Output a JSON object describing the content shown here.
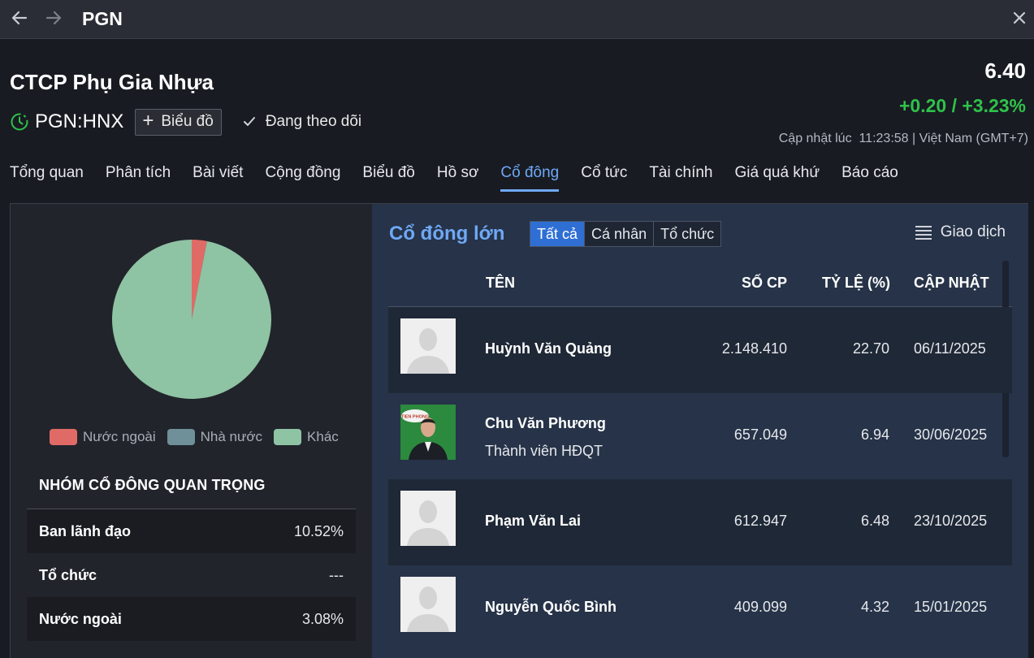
{
  "window": {
    "title": "PGN"
  },
  "header": {
    "company_name": "CTCP Phụ Gia Nhựa",
    "ticker": "PGN:HNX",
    "chart_button": "Biểu đồ",
    "follow_label": "Đang theo dõi",
    "price": "6.40",
    "change": "+0.20 / +3.23%",
    "updated": "Cập nhật lúc  11:23:58 | Việt Nam (GMT+7)",
    "colors": {
      "up": "#2fc24a",
      "accent": "#6fa8f5"
    }
  },
  "tabs": [
    {
      "label": "Tổng quan"
    },
    {
      "label": "Phân tích"
    },
    {
      "label": "Bài viết"
    },
    {
      "label": "Cộng đồng"
    },
    {
      "label": "Biểu đồ"
    },
    {
      "label": "Hồ sơ"
    },
    {
      "label": "Cổ đông",
      "active": true
    },
    {
      "label": "Cổ tức"
    },
    {
      "label": "Tài chính"
    },
    {
      "label": "Giá quá khứ"
    },
    {
      "label": "Báo cáo"
    }
  ],
  "ownership_chart": {
    "type": "pie",
    "legend": [
      {
        "label": "Nước ngoài",
        "color": "#e06b66"
      },
      {
        "label": "Nhà nước",
        "color": "#6f8f99"
      },
      {
        "label": "Khác",
        "color": "#8ec3a4"
      }
    ],
    "slices": [
      {
        "label": "Nước ngoài",
        "value": 3.08,
        "color": "#e06b66"
      },
      {
        "label": "Nhà nước",
        "value": 0,
        "color": "#6f8f99"
      },
      {
        "label": "Khác",
        "value": 96.92,
        "color": "#8ec3a4"
      }
    ]
  },
  "key_groups": {
    "title": "NHÓM CỔ ĐÔNG QUAN TRỌNG",
    "rows": [
      {
        "name": "Ban lãnh đạo",
        "value": "10.52%"
      },
      {
        "name": "Tổ chức",
        "value": "---"
      },
      {
        "name": "Nước ngoài",
        "value": "3.08%"
      }
    ]
  },
  "major_holders": {
    "title": "Cổ đông lớn",
    "filters": [
      "Tất cả",
      "Cá nhân",
      "Tổ chức"
    ],
    "active_filter": "Tất cả",
    "trades_label": "Giao dịch",
    "columns": [
      "TÊN",
      "SỐ CP",
      "TỶ LỆ (%)",
      "CẬP NHẬT"
    ],
    "rows": [
      {
        "name": "Huỳnh Văn Quảng",
        "role": "",
        "shares": "2.148.410",
        "ratio": "22.70",
        "date": "06/11/2025",
        "avatar": "placeholder-avatar"
      },
      {
        "name": "Chu Văn Phương",
        "role": "Thành viên HĐQT",
        "shares": "657.049",
        "ratio": "6.94",
        "date": "30/06/2025",
        "avatar": "photo-avatar",
        "avatar_badge": "TIEN PHONG"
      },
      {
        "name": "Phạm Văn Lai",
        "role": "",
        "shares": "612.947",
        "ratio": "6.48",
        "date": "23/10/2025",
        "avatar": "placeholder-avatar"
      },
      {
        "name": "Nguyễn Quốc Bình",
        "role": "",
        "shares": "409.099",
        "ratio": "4.32",
        "date": "15/01/2025",
        "avatar": "placeholder-avatar"
      }
    ]
  }
}
